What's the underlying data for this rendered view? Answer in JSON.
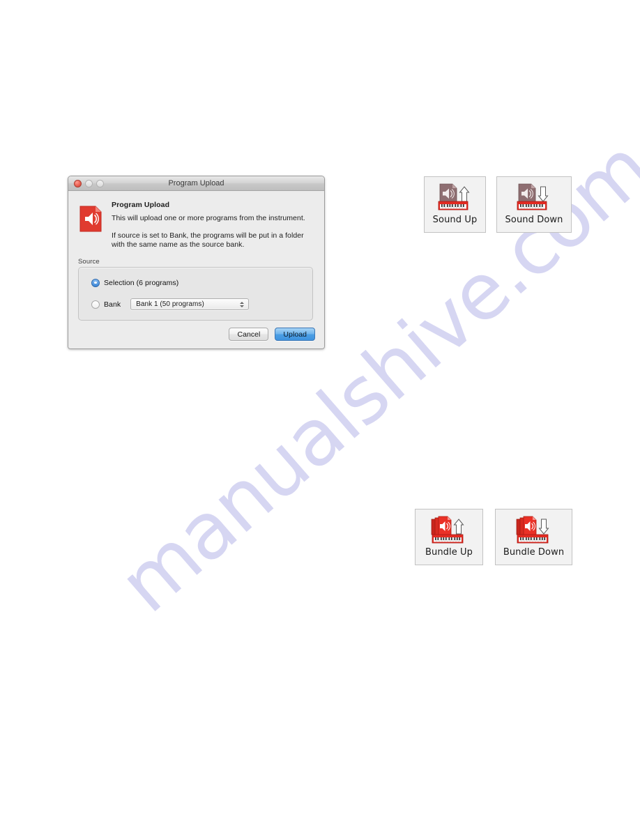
{
  "watermark": {
    "text": "manualshive.com",
    "color": "#d6d6f2"
  },
  "dialog": {
    "titlebar": {
      "title": "Program Upload",
      "close_label": "close",
      "minimize_label": "minimize",
      "maximize_label": "maximize"
    },
    "icon_name": "program-sound-document-icon",
    "heading": "Program Upload",
    "paragraphs": [
      "This will upload one or more programs from the instrument.",
      "If source is set to Bank, the programs will be put in a folder with the same name as the source bank."
    ],
    "source_group": {
      "label": "Source",
      "options": [
        {
          "id": "selection",
          "label": "Selection (6 programs)",
          "selected": true
        },
        {
          "id": "bank",
          "label": "Bank",
          "selected": false
        }
      ],
      "bank_popup": {
        "value": "Bank 1 (50 programs)",
        "options": [
          "Bank 1 (50 programs)"
        ]
      }
    },
    "buttons": {
      "cancel": "Cancel",
      "upload": "Upload",
      "default_button": "upload",
      "accent_color": "#4b9ee4"
    }
  },
  "icon_buttons": [
    {
      "id": "sound-up",
      "caption": "Sound Up",
      "icon": "sound-document-up-arrow-keyboard-icon",
      "direction": "up",
      "stacked": false
    },
    {
      "id": "sound-down",
      "caption": "Sound Down",
      "icon": "sound-document-down-arrow-keyboard-icon",
      "direction": "down",
      "stacked": false
    },
    {
      "id": "bundle-up",
      "caption": "Bundle Up",
      "icon": "bundle-stack-up-arrow-keyboard-icon",
      "direction": "up",
      "stacked": true
    },
    {
      "id": "bundle-down",
      "caption": "Bundle Down",
      "icon": "bundle-stack-down-arrow-keyboard-icon",
      "direction": "down",
      "stacked": true
    }
  ],
  "colors": {
    "document_red": "#e03b30",
    "keyboard_red": "#e22b22",
    "window_bg": "#ececec",
    "group_bg": "#e6e6e6"
  }
}
